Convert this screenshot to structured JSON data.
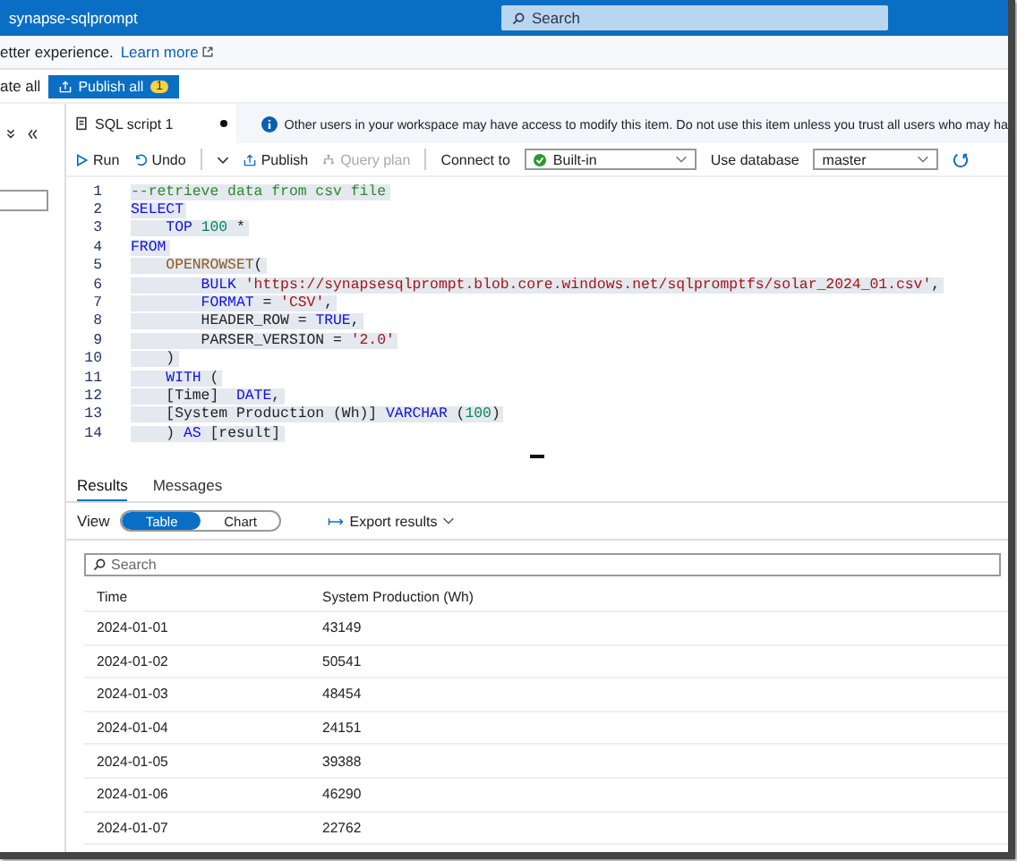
{
  "title_bar": {
    "title": "synapse-sqlprompt",
    "search": {
      "placeholder": "Search"
    }
  },
  "info_bar": {
    "text": "etter experience.",
    "link": "Learn more"
  },
  "main_toolbar": {
    "validate": "ate all",
    "publish": {
      "label": "Publish all",
      "badge": "1"
    }
  },
  "editor_tab": {
    "title": "SQL script 1",
    "modified": true
  },
  "notice": "Other users in your workspace may have access to modify this item. Do not use this item unless you trust all users who may ha",
  "script_toolbar": {
    "run": "Run",
    "undo": "Undo",
    "publish": "Publish",
    "query_plan": {
      "label": "Query plan",
      "disabled": true
    },
    "connect_label": "Connect to",
    "connect_value": "Built-in",
    "database_label": "Use database",
    "database_value": "master"
  },
  "code": {
    "selected": true,
    "lines": [
      {
        "number": "1",
        "tokens": [
          {
            "kind": "comment",
            "text": "--retrieve data from csv file"
          }
        ]
      },
      {
        "number": "2",
        "tokens": [
          {
            "kind": "keyword",
            "text": "SELECT"
          }
        ]
      },
      {
        "number": "3",
        "tokens": [
          {
            "kind": "keyword",
            "text": "    TOP"
          },
          {
            "kind": "number",
            "text": " 100"
          },
          {
            "kind": "plain",
            "text": " *"
          }
        ]
      },
      {
        "number": "4",
        "tokens": [
          {
            "kind": "keyword",
            "text": "FROM"
          }
        ]
      },
      {
        "number": "5",
        "tokens": [
          {
            "kind": "function",
            "text": "    OPENROWSET"
          },
          {
            "kind": "plain",
            "text": "("
          }
        ]
      },
      {
        "number": "6",
        "tokens": [
          {
            "kind": "keyword",
            "text": "        BULK"
          },
          {
            "kind": "string",
            "text": " 'https://synapsesqlprompt.blob.core.windows.net/sqlpromptfs/solar_2024_01.csv'"
          },
          {
            "kind": "plain",
            "text": ","
          }
        ]
      },
      {
        "number": "7",
        "tokens": [
          {
            "kind": "keyword",
            "text": "        FORMAT"
          },
          {
            "kind": "plain",
            "text": " ="
          },
          {
            "kind": "string",
            "text": " 'CSV'"
          },
          {
            "kind": "plain",
            "text": ","
          }
        ]
      },
      {
        "number": "8",
        "tokens": [
          {
            "kind": "plain",
            "text": "        HEADER_ROW ="
          },
          {
            "kind": "keyword",
            "text": " TRUE"
          },
          {
            "kind": "plain",
            "text": ","
          }
        ]
      },
      {
        "number": "9",
        "tokens": [
          {
            "kind": "plain",
            "text": "        PARSER_VERSION ="
          },
          {
            "kind": "string",
            "text": " '2.0'"
          }
        ]
      },
      {
        "number": "10",
        "tokens": [
          {
            "kind": "plain",
            "text": "    )"
          }
        ]
      },
      {
        "number": "11",
        "tokens": [
          {
            "kind": "keyword",
            "text": "    WITH"
          },
          {
            "kind": "plain",
            "text": " ("
          }
        ]
      },
      {
        "number": "12",
        "tokens": [
          {
            "kind": "plain",
            "text": "    [Time]"
          },
          {
            "kind": "keyword",
            "text": "  DATE"
          },
          {
            "kind": "plain",
            "text": ","
          }
        ]
      },
      {
        "number": "13",
        "tokens": [
          {
            "kind": "plain",
            "text": "    [System Production (Wh)]"
          },
          {
            "kind": "keyword",
            "text": " VARCHAR"
          },
          {
            "kind": "plain",
            "text": " ("
          },
          {
            "kind": "number",
            "text": "100"
          },
          {
            "kind": "plain",
            "text": ")"
          }
        ]
      },
      {
        "number": "14",
        "tokens": [
          {
            "kind": "plain",
            "text": "    )"
          },
          {
            "kind": "keyword",
            "text": " AS"
          },
          {
            "kind": "plain",
            "text": " [result]"
          }
        ]
      }
    ]
  },
  "results": {
    "tabs": [
      {
        "label": "Results",
        "selected": true
      },
      {
        "label": "Messages",
        "selected": false
      }
    ],
    "view_label": "View",
    "view_options": [
      {
        "label": "Table",
        "selected": true
      },
      {
        "label": "Chart",
        "selected": false
      }
    ],
    "export": "Export results",
    "search": {
      "placeholder": "Search"
    },
    "columns": [
      "Time",
      "System Production (Wh)"
    ],
    "rows": [
      [
        "2024-01-01",
        "43149"
      ],
      [
        "2024-01-02",
        "50541"
      ],
      [
        "2024-01-03",
        "48454"
      ],
      [
        "2024-01-04",
        "24151"
      ],
      [
        "2024-01-05",
        "39388"
      ],
      [
        "2024-01-06",
        "46290"
      ],
      [
        "2024-01-07",
        "22762"
      ]
    ]
  }
}
